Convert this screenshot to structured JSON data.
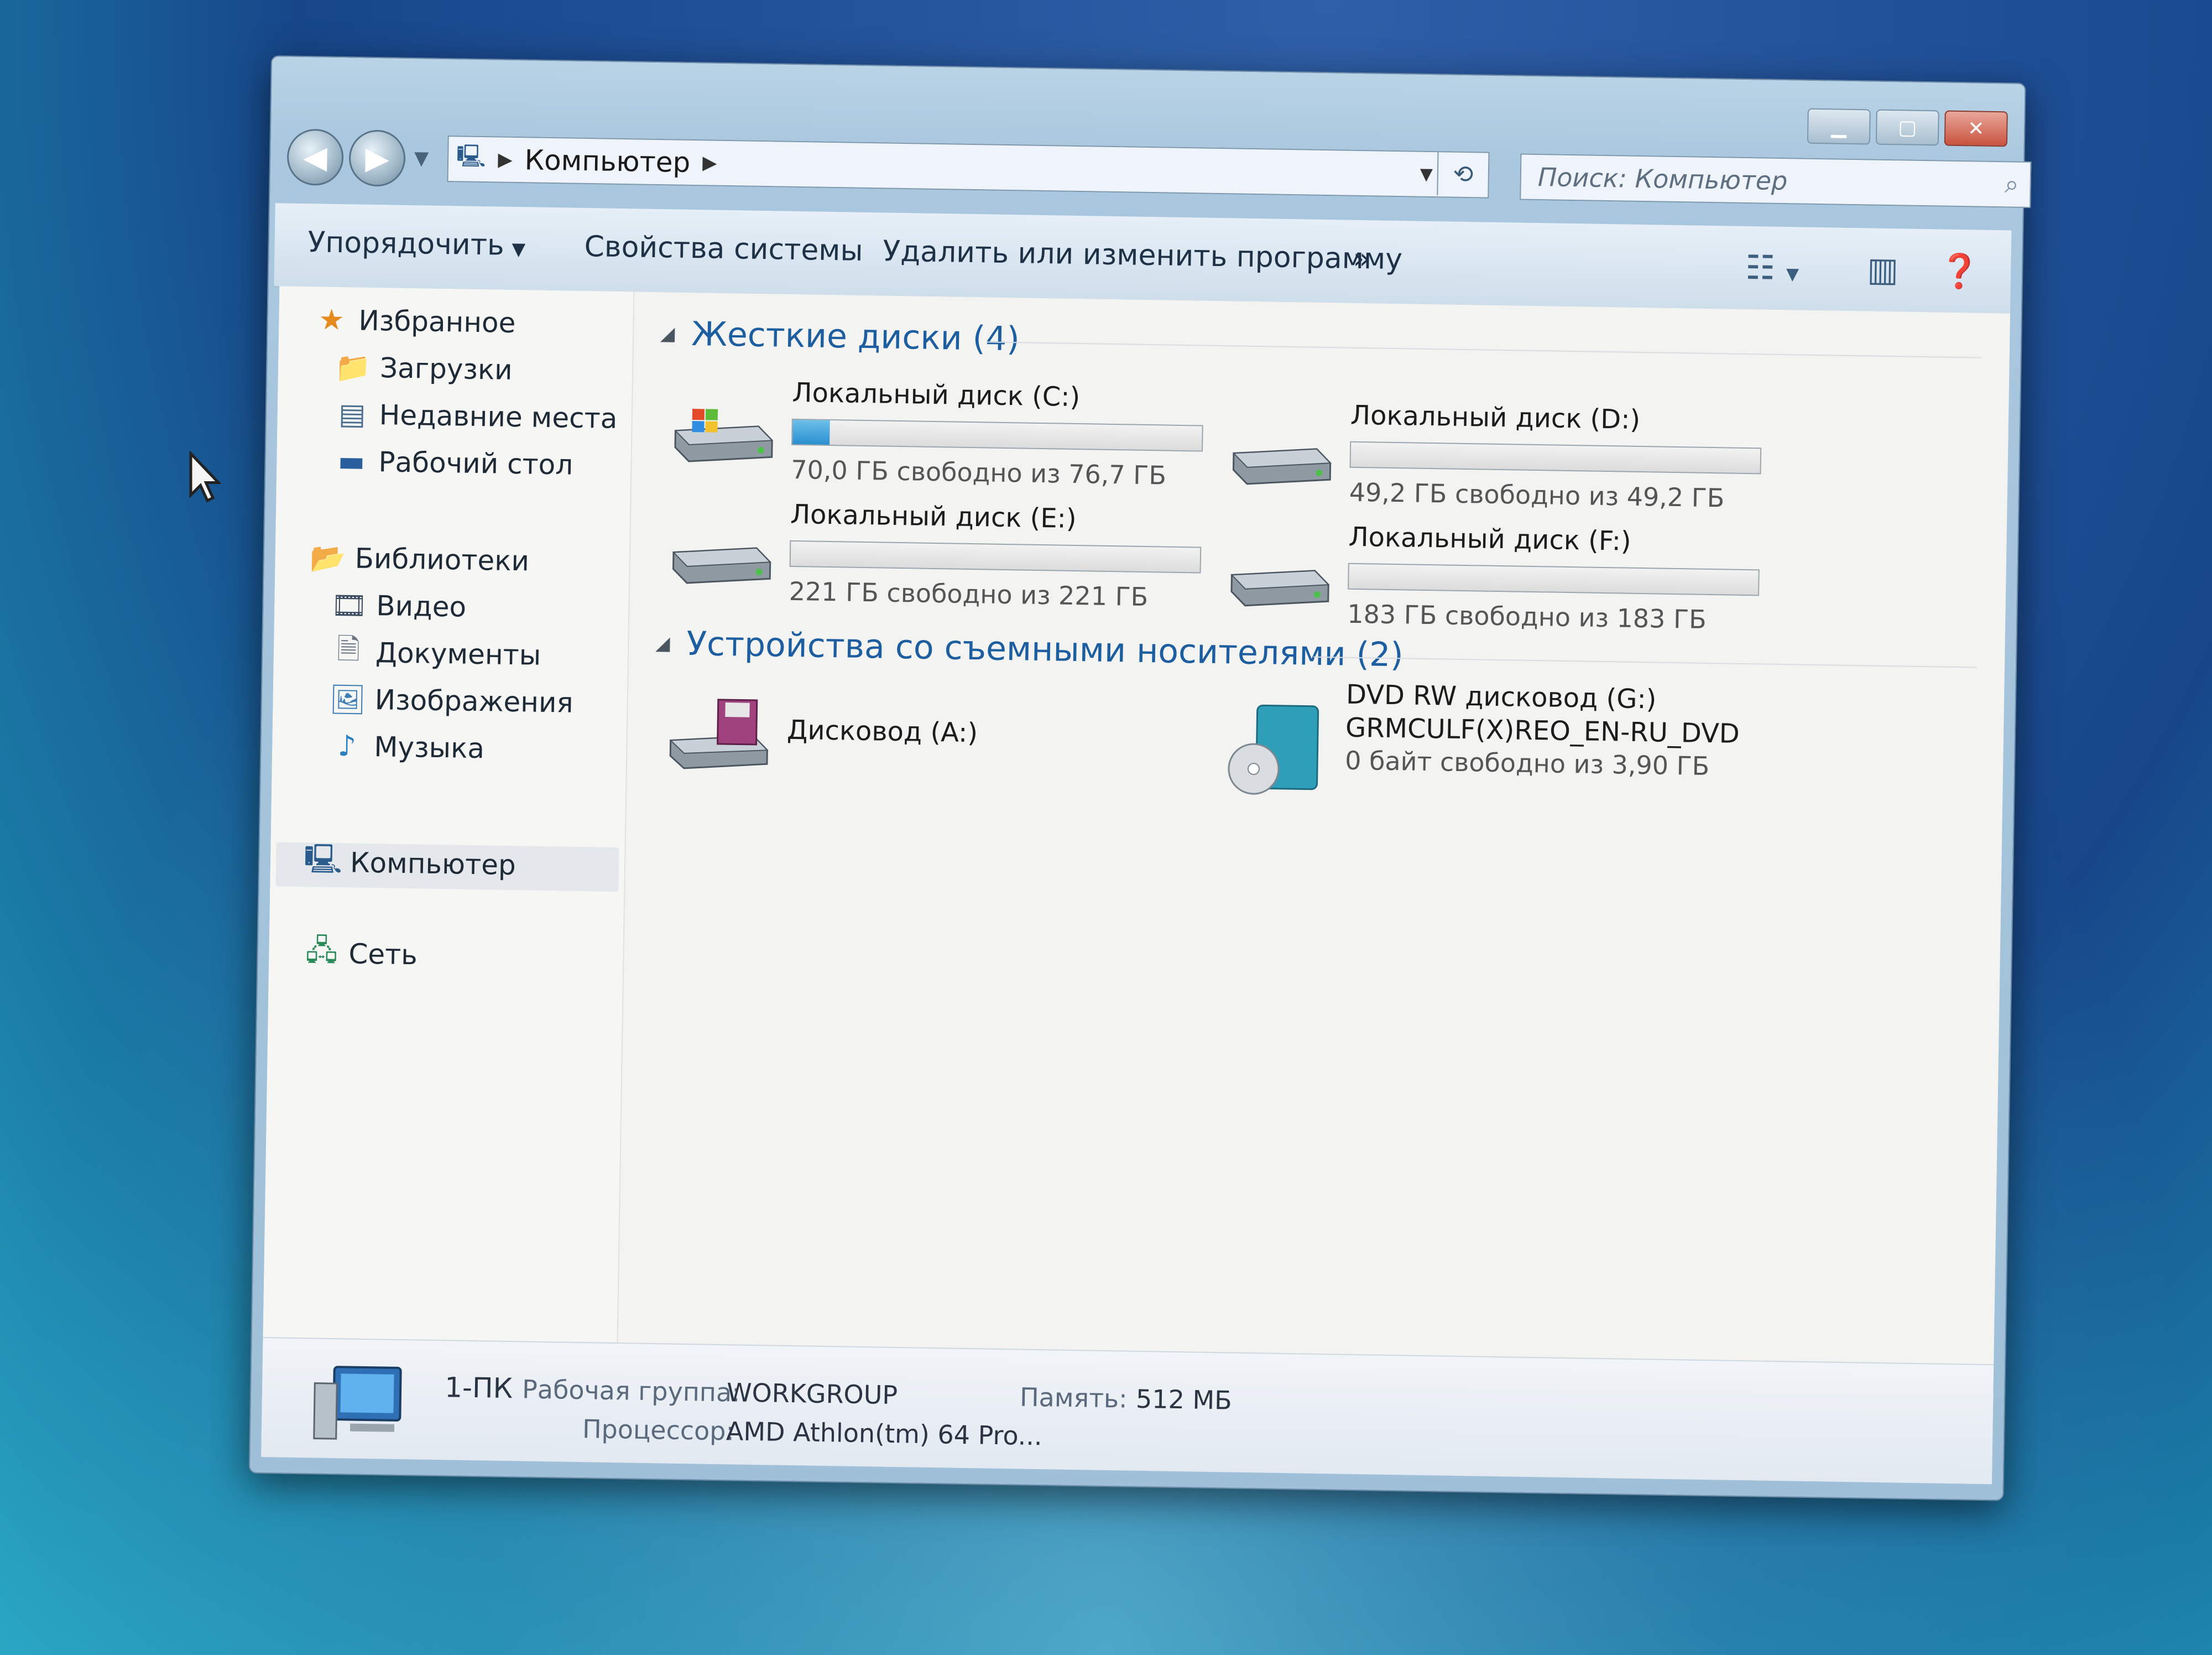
{
  "window": {
    "address": {
      "crumb": "Компьютер"
    },
    "search": {
      "placeholder": "Поиск: Компьютер"
    }
  },
  "toolbar": {
    "organize": "Упорядочить",
    "system_properties": "Свойства системы",
    "uninstall": "Удалить или изменить программу",
    "more": "»"
  },
  "sidebar": {
    "favorites": {
      "title": "Избранное",
      "items": [
        "Загрузки",
        "Недавние места",
        "Рабочий стол"
      ]
    },
    "libraries": {
      "title": "Библиотеки",
      "items": [
        "Видео",
        "Документы",
        "Изображения",
        "Музыка"
      ]
    },
    "computer": "Компьютер",
    "network": "Сеть"
  },
  "groups": {
    "hard_drives": {
      "title": "Жесткие диски (4)",
      "drives": [
        {
          "name": "Локальный диск (C:)",
          "free_text": "70,0 ГБ свободно из 76,7 ГБ",
          "used_fraction": 0.09
        },
        {
          "name": "Локальный диск (D:)",
          "free_text": "49,2 ГБ свободно из 49,2 ГБ",
          "used_fraction": 0.0
        },
        {
          "name": "Локальный диск (E:)",
          "free_text": "221 ГБ свободно из 221 ГБ",
          "used_fraction": 0.0
        },
        {
          "name": "Локальный диск (F:)",
          "free_text": "183 ГБ свободно из 183 ГБ",
          "used_fraction": 0.0
        }
      ]
    },
    "removable": {
      "title": "Устройства со съемными носителями (2)",
      "floppy": {
        "name": "Дисковод (A:)"
      },
      "dvd": {
        "name": "DVD RW дисковод (G:)",
        "label": "GRMCULF(X)REO_EN-RU_DVD",
        "free_text": "0 байт свободно из 3,90 ГБ"
      }
    }
  },
  "details": {
    "computer_name": "1-ПК",
    "workgroup_label": "Рабочая группа:",
    "workgroup_value": "WORKGROUP",
    "memory_label": "Память:",
    "memory_value": "512 МБ",
    "cpu_label": "Процессор:",
    "cpu_value": "AMD Athlon(tm) 64 Pro..."
  }
}
